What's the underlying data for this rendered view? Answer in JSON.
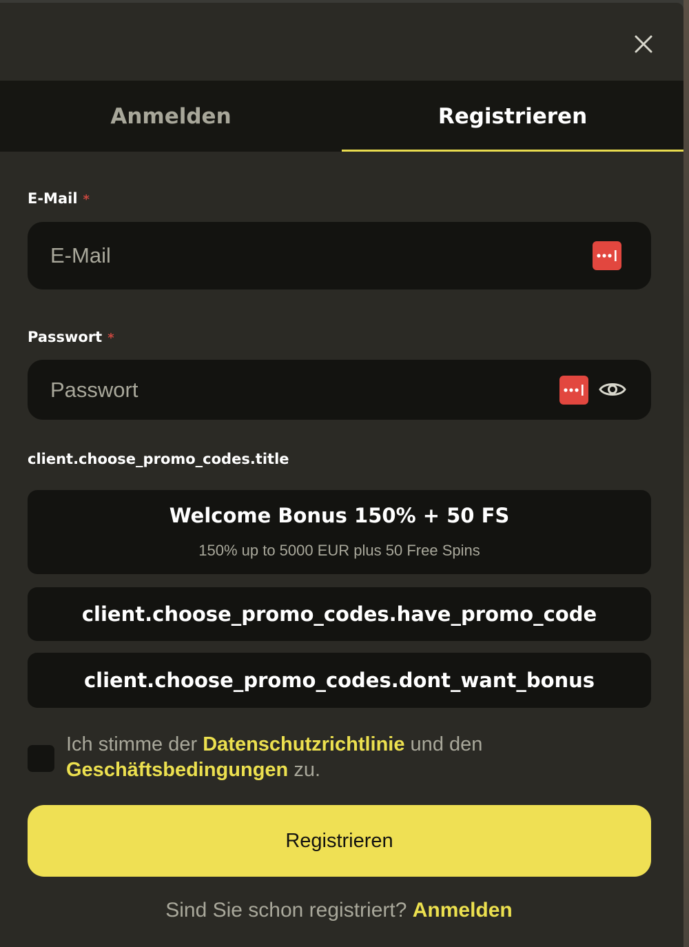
{
  "tabs": [
    {
      "label": "Anmelden",
      "active": false
    },
    {
      "label": "Registrieren",
      "active": true
    }
  ],
  "email": {
    "label": "E-Mail",
    "required_mark": "*",
    "placeholder": "E-Mail",
    "value": ""
  },
  "password": {
    "label": "Passwort",
    "required_mark": "*",
    "placeholder": "Passwort",
    "value": ""
  },
  "promo": {
    "title": "client.choose_promo_codes.title",
    "options": [
      {
        "title": "Welcome Bonus 150% + 50 FS",
        "subtitle": "150% up to 5000 EUR plus 50 Free Spins"
      },
      {
        "title": "client.choose_promo_codes.have_promo_code"
      },
      {
        "title": "client.choose_promo_codes.dont_want_bonus"
      }
    ]
  },
  "consent": {
    "checked": false,
    "text_before": "Ich stimme der ",
    "privacy_link": "Datenschutzrichtlinie",
    "text_middle": " und den ",
    "terms_link": "Geschäftsbedingungen",
    "text_after": " zu."
  },
  "submit_label": "Registrieren",
  "footer": {
    "question": "Sind Sie schon registriert? ",
    "login_link": "Anmelden"
  },
  "colors": {
    "accent": "#efe054",
    "background": "#2b2a25",
    "field": "#131310",
    "password_manager_icon": "#e2473f"
  },
  "icons": {
    "close": "close-icon",
    "password_manager": "password-manager-icon",
    "visibility": "eye-icon"
  }
}
